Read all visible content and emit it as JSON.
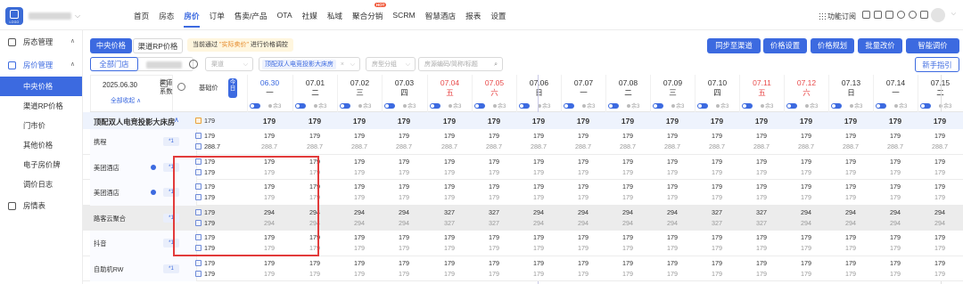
{
  "topbar": {
    "logo_text": "LOGO",
    "store_name": "",
    "nav": [
      "首页",
      "房态",
      "房价",
      "订单",
      "售卖/产品",
      "OTA",
      "社媒",
      "私域",
      "聚合分销",
      "SCRM",
      "智慧酒店",
      "报表",
      "设置"
    ],
    "nav_active": "房价",
    "hot_badge": "HOT",
    "subscribe_label": "功能订阅"
  },
  "sidebar": {
    "groups": [
      {
        "label": "房态管理",
        "open": false
      },
      {
        "label": "房价管理",
        "open": true
      }
    ],
    "subitems": [
      "中央价格",
      "渠道RP价格",
      "门市价",
      "其他价格",
      "电子房价牌",
      "调价日志"
    ],
    "active_subitem": "中央价格",
    "bottom_item": "房情表"
  },
  "toolbar": {
    "tab_central": "中央价格",
    "tab_channel_rp": "渠道RP价格",
    "notice_prefix": "当前通过",
    "notice_highlight": "\"实际卖价\"",
    "notice_suffix": "进行价格调控",
    "btn_sync": "同步至渠道",
    "btn_price_setting": "价格设置",
    "btn_price_plan": "价格规划",
    "btn_batch": "批量改价",
    "btn_smart": "智能调价",
    "btn_guide": "新手指引",
    "store_all": "全部门店",
    "channel_placeholder": "渠道",
    "room_tag": "顶配双人电竞投影大床房",
    "roomtype_placeholder": "房型分组",
    "search_placeholder": "房源编码/简称/标题"
  },
  "header": {
    "date_label": "2025.06.30",
    "collapse_label": "全部收起",
    "coef_label": "渠道系数",
    "base_label": "基础价",
    "today_label": "今日",
    "dates": [
      {
        "d": "06.30",
        "w": "一"
      },
      {
        "d": "07.01",
        "w": "二"
      },
      {
        "d": "07.02",
        "w": "三"
      },
      {
        "d": "07.03",
        "w": "四"
      },
      {
        "d": "07.04",
        "w": "五"
      },
      {
        "d": "07.05",
        "w": "六"
      },
      {
        "d": "07.06",
        "w": "日"
      },
      {
        "d": "07.07",
        "w": "一"
      },
      {
        "d": "07.08",
        "w": "二"
      },
      {
        "d": "07.09",
        "w": "三"
      },
      {
        "d": "07.10",
        "w": "四"
      },
      {
        "d": "07.11",
        "w": "五"
      },
      {
        "d": "07.12",
        "w": "六"
      },
      {
        "d": "07.13",
        "w": "日"
      },
      {
        "d": "07.14",
        "w": "一"
      },
      {
        "d": "07.15",
        "w": "二"
      }
    ],
    "remain_label": "余3"
  },
  "room": {
    "name": "顶配双人电竞投影大床房",
    "base": "179",
    "prices": [
      "179",
      "179",
      "179",
      "179",
      "179",
      "179",
      "179",
      "179",
      "179",
      "179",
      "179",
      "179",
      "179",
      "179",
      "179",
      "179"
    ]
  },
  "channels": [
    {
      "name": "携程",
      "coef": "*1",
      "base1": "179",
      "base2": "288.7",
      "r1": [
        "179",
        "179",
        "179",
        "179",
        "179",
        "179",
        "179",
        "179",
        "179",
        "179",
        "179",
        "179",
        "179",
        "179",
        "179",
        "179"
      ],
      "r2": [
        "288.7",
        "288.7",
        "288.7",
        "288.7",
        "288.7",
        "288.7",
        "288.7",
        "288.7",
        "288.7",
        "288.7",
        "288.7",
        "288.7",
        "288.7",
        "288.7",
        "288.7",
        "288.7"
      ],
      "dot": false
    },
    {
      "name": "美团酒店",
      "coef": "*1",
      "base1": "179",
      "base2": "179",
      "r1": [
        "179",
        "179",
        "179",
        "179",
        "179",
        "179",
        "179",
        "179",
        "179",
        "179",
        "179",
        "179",
        "179",
        "179",
        "179",
        "179"
      ],
      "r2": [
        "179",
        "179",
        "179",
        "179",
        "179",
        "179",
        "179",
        "179",
        "179",
        "179",
        "179",
        "179",
        "179",
        "179",
        "179",
        "179"
      ],
      "dot": true
    },
    {
      "name": "美团酒店",
      "coef": "*1",
      "base1": "179",
      "base2": "179",
      "r1": [
        "179",
        "179",
        "179",
        "179",
        "179",
        "179",
        "179",
        "179",
        "179",
        "179",
        "179",
        "179",
        "179",
        "179",
        "179",
        "179"
      ],
      "r2": [
        "179",
        "179",
        "179",
        "179",
        "179",
        "179",
        "179",
        "179",
        "179",
        "179",
        "179",
        "179",
        "179",
        "179",
        "179",
        "179"
      ],
      "dot": true
    },
    {
      "name": "路客云聚合",
      "coef": "*1",
      "base1": "179",
      "base2": "179",
      "r1": [
        "294",
        "294",
        "294",
        "294",
        "327",
        "327",
        "294",
        "294",
        "294",
        "294",
        "327",
        "327",
        "294",
        "294",
        "294",
        "294"
      ],
      "r2": [
        "294",
        "294",
        "294",
        "294",
        "327",
        "327",
        "294",
        "294",
        "294",
        "294",
        "327",
        "327",
        "294",
        "294",
        "294",
        "294"
      ],
      "dot": false
    },
    {
      "name": "抖音",
      "coef": "*1",
      "base1": "179",
      "base2": "179",
      "r1": [
        "179",
        "179",
        "179",
        "179",
        "179",
        "179",
        "179",
        "179",
        "179",
        "179",
        "179",
        "179",
        "179",
        "179",
        "179",
        "179"
      ],
      "r2": [
        "179",
        "179",
        "179",
        "179",
        "179",
        "179",
        "179",
        "179",
        "179",
        "179",
        "179",
        "179",
        "179",
        "179",
        "179",
        "179"
      ],
      "dot": false
    },
    {
      "name": "自助机RW",
      "coef": "*1",
      "base1": "179",
      "base2": "179",
      "r1": [
        "179",
        "179",
        "179",
        "179",
        "179",
        "179",
        "179",
        "179",
        "179",
        "179",
        "179",
        "179",
        "179",
        "179",
        "179",
        "179"
      ],
      "r2": [
        "179",
        "179",
        "179",
        "179",
        "179",
        "179",
        "179",
        "179",
        "179",
        "179",
        "179",
        "179",
        "179",
        "179",
        "179",
        "179"
      ],
      "dot": false
    }
  ]
}
